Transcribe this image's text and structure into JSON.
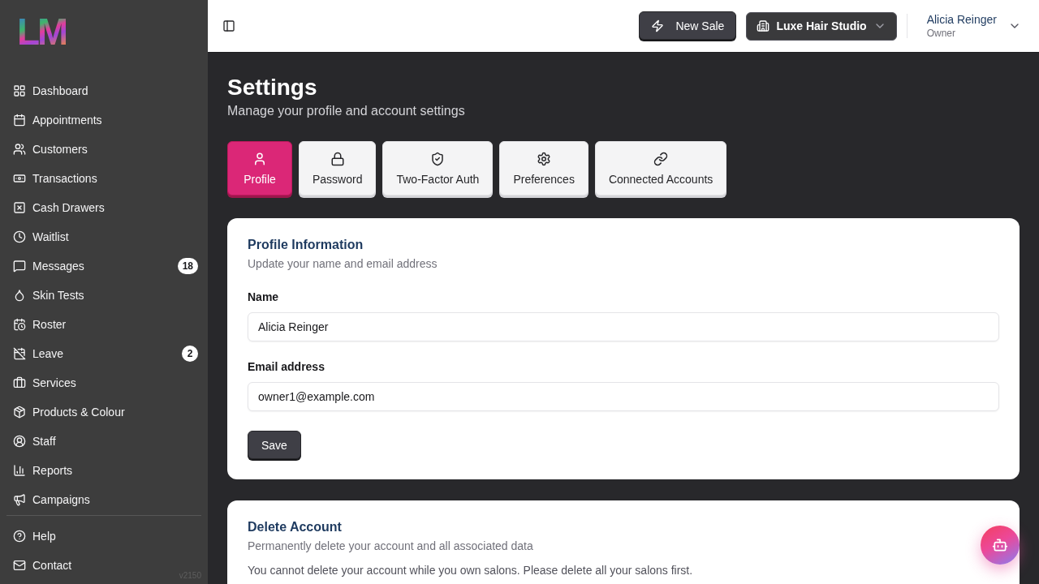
{
  "sidebar": {
    "logo": "LM",
    "items": [
      {
        "label": "Dashboard",
        "selected": false
      },
      {
        "label": "Appointments",
        "selected": false
      },
      {
        "label": "Customers",
        "selected": false
      },
      {
        "label": "Transactions",
        "selected": false
      },
      {
        "label": "Cash Drawers",
        "selected": false
      },
      {
        "label": "Waitlist",
        "selected": false
      },
      {
        "label": "Messages",
        "badge": "18",
        "selected": false
      },
      {
        "label": "Skin Tests",
        "selected": false
      },
      {
        "label": "Roster",
        "selected": false
      },
      {
        "label": "Leave",
        "badge": "2",
        "selected": false
      },
      {
        "label": "Services",
        "selected": false
      },
      {
        "label": "Products & Colour",
        "selected": false
      },
      {
        "label": "Staff",
        "selected": false
      },
      {
        "label": "Reports",
        "selected": false
      },
      {
        "label": "Campaigns",
        "selected": false
      }
    ],
    "footer_items": [
      {
        "label": "Help",
        "selected": false
      },
      {
        "label": "Contact",
        "selected": false
      }
    ],
    "version": "v2150"
  },
  "header": {
    "new_sale_button": "New Sale",
    "salon_switcher": "Luxe Hair Studio",
    "user": {
      "name": "Alicia Reinger",
      "role": "Owner"
    }
  },
  "page": {
    "title": "Settings",
    "subtitle": "Manage your profile and account settings"
  },
  "tabs": [
    {
      "label": "Profile",
      "selected": true
    },
    {
      "label": "Password",
      "selected": false
    },
    {
      "label": "Two-Factor Auth",
      "selected": false
    },
    {
      "label": "Preferences",
      "selected": false
    },
    {
      "label": "Connected Accounts",
      "selected": false
    }
  ],
  "profile_card": {
    "title": "Profile Information",
    "description": "Update your name and email address",
    "fields": [
      {
        "label": "Name",
        "value": "Alicia Reinger"
      },
      {
        "label": "Email address",
        "value": "owner1@example.com"
      }
    ],
    "save_button": "Save"
  },
  "delete_card": {
    "title": "Delete Account",
    "description": "Permanently delete your account and all associated data",
    "notice": "You cannot delete your account while you own salons. Please delete all your salons first."
  }
}
